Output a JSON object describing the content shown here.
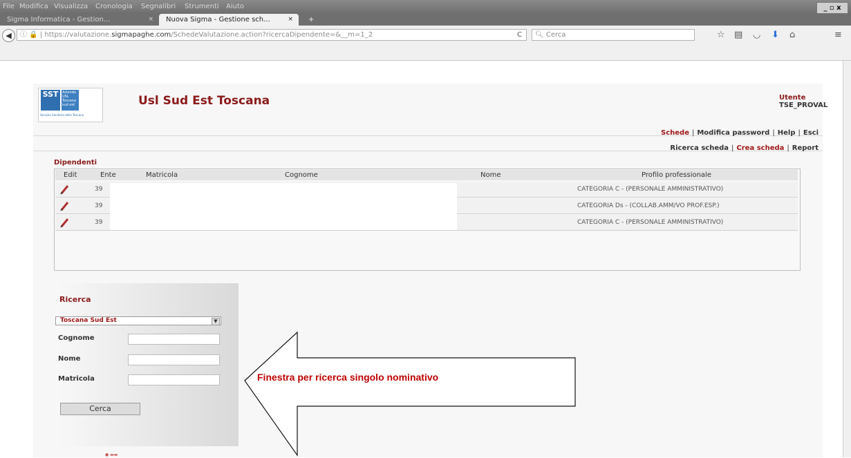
{
  "menubar": {
    "items": [
      "File",
      "Modifica",
      "Visualizza",
      "Cronologia",
      "Segnalibri",
      "Strumenti",
      "Aiuto"
    ],
    "window_buttons": "_ ▫ x"
  },
  "tabs": [
    {
      "label": "Sigma Informatica - Gestion...",
      "active": false
    },
    {
      "label": "Nuova Sigma - Gestione sch...",
      "active": true
    }
  ],
  "tab_close": "×",
  "new_tab": "+",
  "navbar": {
    "url_prefix": "https://valutazione.",
    "url_domain": "sigmapaghe.com",
    "url_rest": "/SchedeValutazione.action?ricercaDipendente=&__m=1_2",
    "search_placeholder": "Cerca"
  },
  "header": {
    "logo_text": "SST",
    "logo_lines": "Azienda USL Toscana sud est",
    "logo_sub": "Servizio Sanitario della Toscana",
    "title": "Usl Sud Est Toscana",
    "user_label": "Utente",
    "user_name": "TSE_PROVAL"
  },
  "nav_primary": [
    "Schede",
    "Modifica password",
    "Help",
    "Esci"
  ],
  "nav_secondary": [
    "Ricerca scheda",
    "Crea scheda",
    "Report"
  ],
  "nav_separator": "|",
  "dipendenti": {
    "title": "Dipendenti",
    "columns": [
      "Edit",
      "Ente",
      "Matricola",
      "Cognome",
      "Nome",
      "Profilo professionale"
    ],
    "rows": [
      {
        "ente": "39",
        "profilo": "CATEGORIA C - (PERSONALE AMMINISTRATIVO)"
      },
      {
        "ente": "39",
        "profilo": "CATEGORIA Ds - (COLLAB.AMM/VO PROF.ESP.)"
      },
      {
        "ente": "39",
        "profilo": "CATEGORIA C - (PERSONALE AMMINISTRATIVO)"
      }
    ]
  },
  "ricerca": {
    "title": "Ricerca",
    "ente_selected": "Toscana Sud Est",
    "fields": [
      "Cognome",
      "Nome",
      "Matricola"
    ],
    "button": "Cerca"
  },
  "annotation": "Finestra per ricerca singolo nominativo",
  "colors": {
    "brand_red": "#8b1a1a",
    "link_red": "#a01818",
    "annotation_red": "#c00000"
  }
}
